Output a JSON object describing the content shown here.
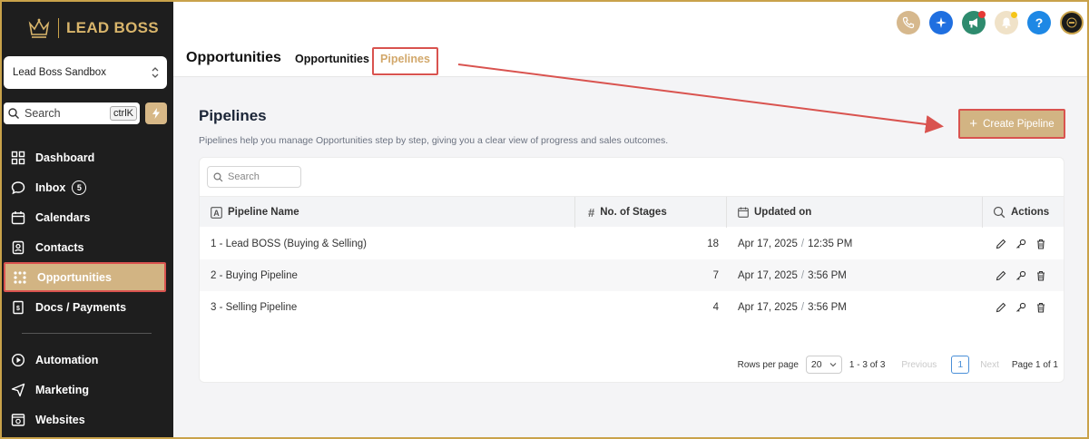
{
  "brand": {
    "name": "LEAD BOSS",
    "accent": "#d2b483",
    "sidebar_bg": "#1e1e1e"
  },
  "account": {
    "name": "Lead Boss Sandbox"
  },
  "sidebar_search": {
    "label": "Search",
    "shortcut": "ctrlK"
  },
  "nav": {
    "items": [
      {
        "label": "Dashboard",
        "icon": "dashboard-icon"
      },
      {
        "label": "Inbox",
        "icon": "chat-icon",
        "badge": "5"
      },
      {
        "label": "Calendars",
        "icon": "calendar-icon"
      },
      {
        "label": "Contacts",
        "icon": "contacts-icon"
      },
      {
        "label": "Opportunities",
        "icon": "opportunities-icon",
        "active": true
      },
      {
        "label": "Docs / Payments",
        "icon": "docs-icon"
      }
    ],
    "secondary": [
      {
        "label": "Automation",
        "icon": "automation-icon"
      },
      {
        "label": "Marketing",
        "icon": "marketing-icon"
      },
      {
        "label": "Websites",
        "icon": "websites-icon"
      }
    ]
  },
  "header": {
    "title": "Opportunities",
    "tabs": [
      {
        "label": "Opportunities"
      },
      {
        "label": "Pipelines",
        "active": true
      }
    ]
  },
  "section": {
    "title": "Pipelines",
    "description": "Pipelines help you manage Opportunities step by step, giving you a clear view of progress and sales outcomes.",
    "create_label": "Create Pipeline"
  },
  "table": {
    "search_placeholder": "Search",
    "columns": [
      "Pipeline Name",
      "No. of Stages",
      "Updated on",
      "Actions"
    ],
    "rows": [
      {
        "name": "1 - Lead BOSS (Buying & Selling)",
        "stages": "18",
        "date": "Apr 17, 2025",
        "time": "12:35 PM"
      },
      {
        "name": "2 - Buying Pipeline",
        "stages": "7",
        "date": "Apr 17, 2025",
        "time": "3:56 PM"
      },
      {
        "name": "3 - Selling Pipeline",
        "stages": "4",
        "date": "Apr 17, 2025",
        "time": "3:56 PM"
      }
    ]
  },
  "pagination": {
    "rows_per_page_label": "Rows per page",
    "rows_per_page": "20",
    "range": "1 - 3 of 3",
    "previous": "Previous",
    "current_page": "1",
    "next": "Next",
    "page_info": "Page 1 of 1"
  }
}
